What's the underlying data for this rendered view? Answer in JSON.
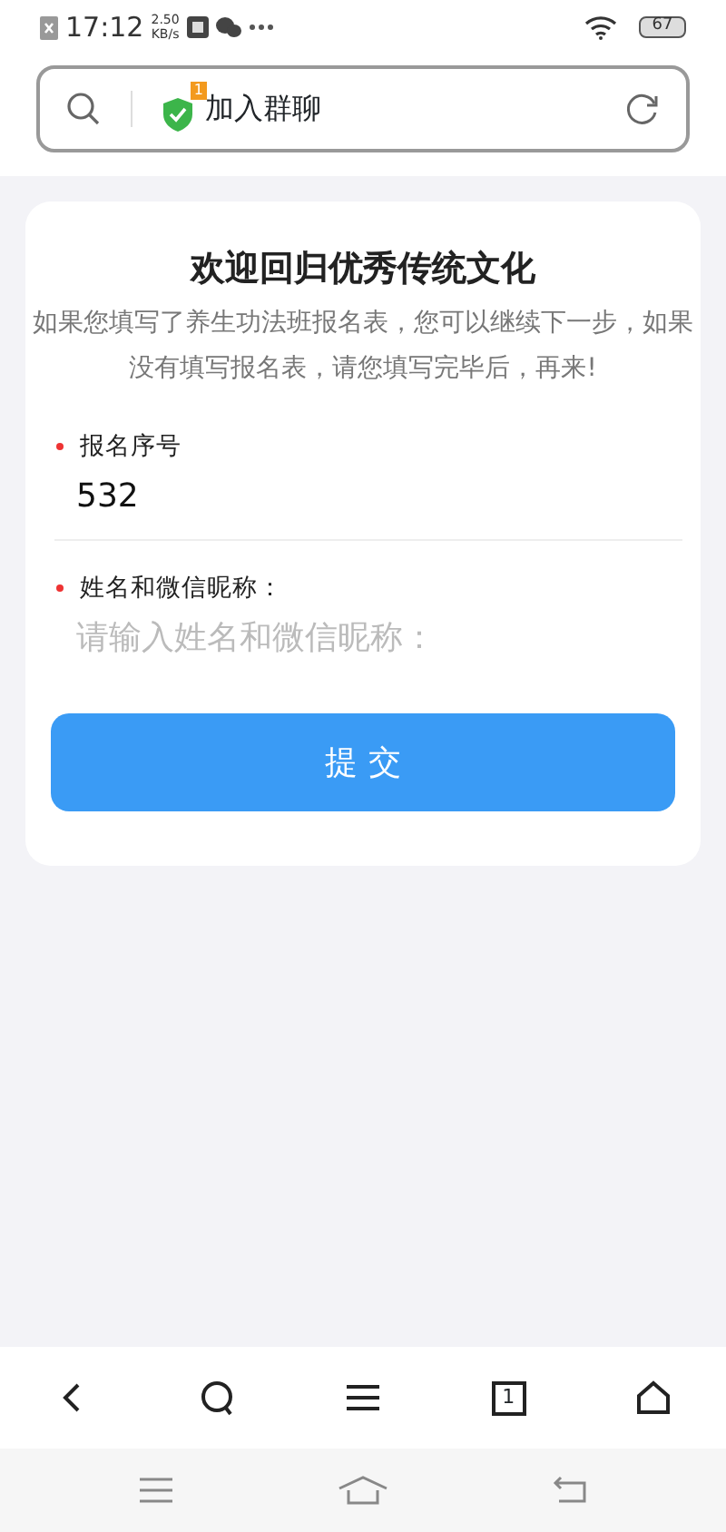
{
  "status_bar": {
    "time": "17:12",
    "speed": "2.50",
    "speed_unit": "KB/s",
    "battery": "67"
  },
  "address_bar": {
    "badge": "1",
    "title": "加入群聊"
  },
  "form": {
    "title": "欢迎回归优秀传统文化",
    "description": "如果您填写了养生功法班报名表，您可以继续下一步，如果没有填写报名表，请您填写完毕后，再来!",
    "fields": [
      {
        "label": "报名序号",
        "required": true,
        "value": "532"
      },
      {
        "label": "姓名和微信昵称：",
        "required": true,
        "placeholder": "请输入姓名和微信昵称："
      }
    ],
    "submit": "提 交"
  },
  "toolbar": {
    "tab_count": "1"
  }
}
